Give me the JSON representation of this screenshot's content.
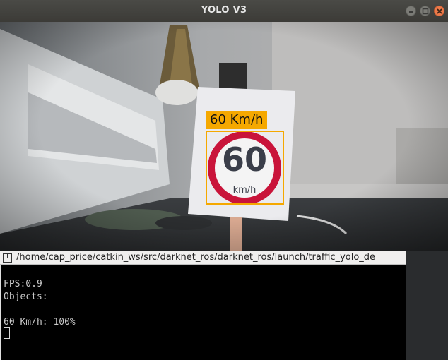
{
  "window": {
    "title": "YOLO V3"
  },
  "detection": {
    "label": "60 Km/h",
    "color": "#f5a800"
  },
  "sign": {
    "number": "60",
    "unit": "km/h"
  },
  "terminal": {
    "path": "/home/cap_price/catkin_ws/src/darknet_ros/darknet_ros/launch/traffic_yolo_de",
    "lines": [
      "FPS:0.9",
      "Objects:",
      "",
      "60 Km/h: 100%"
    ]
  }
}
